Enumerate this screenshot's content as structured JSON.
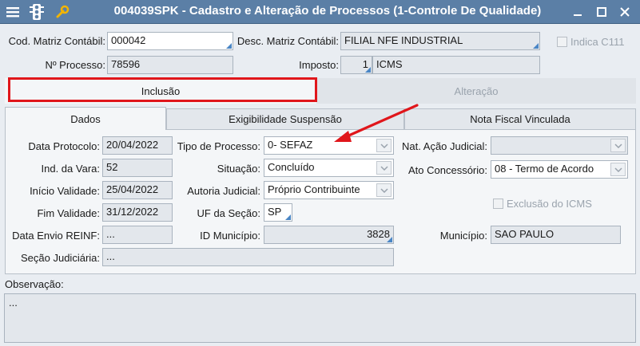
{
  "window": {
    "title": "004039SPK - Cadastro e Alteração de Processos (1-Controle De Qualidade)",
    "icons": [
      "list-icon",
      "traffic-light-icon",
      "wrench-icon"
    ],
    "controls": [
      "minimize-icon",
      "maximize-icon",
      "close-icon"
    ]
  },
  "header": {
    "cod_matriz_label": "Cod. Matriz Contábil:",
    "cod_matriz_value": "000042",
    "desc_matriz_label": "Desc. Matriz Contábil:",
    "desc_matriz_value": "FILIAL NFE INDUSTRIAL",
    "indica_label": "Indica C111",
    "nprocesso_label": "Nº Processo:",
    "nprocesso_value": "78596",
    "imposto_label": "Imposto:",
    "imposto_code": "1",
    "imposto_name": "ICMS"
  },
  "tabs": [
    {
      "label": "Inclusão",
      "active": true
    },
    {
      "label": "Alteração",
      "active": false
    }
  ],
  "subtabs": [
    {
      "label": "Dados",
      "active": true
    },
    {
      "label": "Exigibilidade Suspensão",
      "active": false
    },
    {
      "label": "Nota Fiscal Vinculada",
      "active": false
    }
  ],
  "dados": {
    "data_protocolo_label": "Data Protocolo:",
    "data_protocolo_value": "20/04/2022",
    "ind_vara_label": "Ind. da Vara:",
    "ind_vara_value": "52",
    "inicio_validade_label": "Início Validade:",
    "inicio_validade_value": "25/04/2022",
    "fim_validade_label": "Fim Validade:",
    "fim_validade_value": "31/12/2022",
    "data_envio_label": "Data Envio REINF:",
    "data_envio_value": "...",
    "secao_judiciaria_label": "Seção Judiciária:",
    "secao_judiciaria_value": "...",
    "tipo_processo_label": "Tipo de Processo:",
    "tipo_processo_value": "0- SEFAZ",
    "situacao_label": "Situação:",
    "situacao_value": "Concluído",
    "autoria_label": "Autoria Judicial:",
    "autoria_value": "Próprio Contribuinte",
    "uf_label": "UF da Seção:",
    "uf_value": "SP",
    "id_municipio_label": "ID Município:",
    "id_municipio_value": "3828",
    "nat_acao_label": "Nat. Ação Judicial:",
    "nat_acao_value": "",
    "ato_concessorio_label": "Ato Concessório:",
    "ato_concessorio_value": "08 - Termo de Acordo",
    "exclusao_label": "Exclusão do ICMS",
    "municipio_label": "Município:",
    "municipio_value": "SAO PAULO"
  },
  "observacao": {
    "label": "Observação:",
    "value": "..."
  },
  "colors": {
    "titlebar": "#5b7fa6",
    "highlight": "#e0161b",
    "arrow": "#e0161b"
  }
}
